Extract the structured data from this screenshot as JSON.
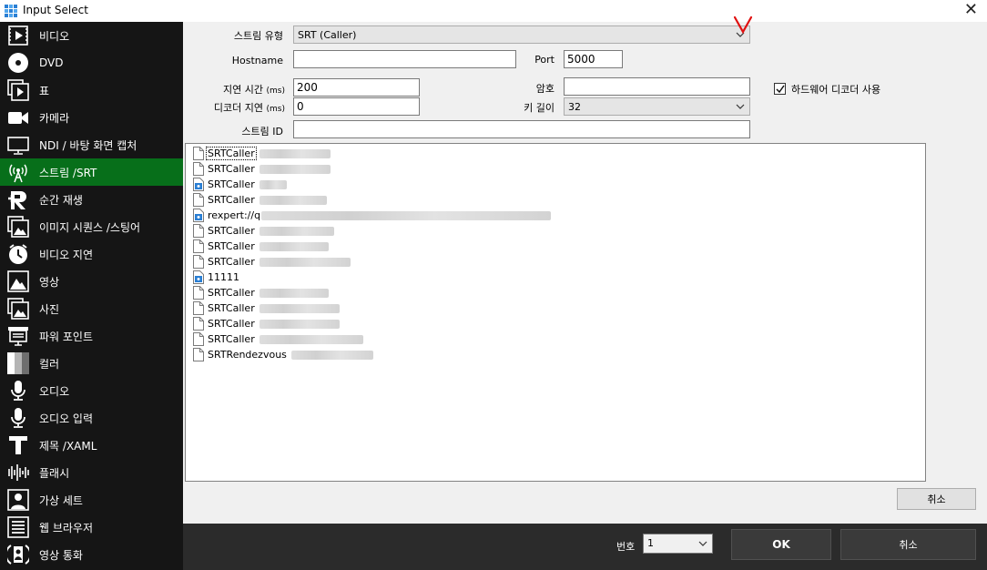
{
  "window": {
    "title": "Input Select",
    "close_glyph": "✕"
  },
  "sidebar": {
    "items": [
      {
        "label": "비디오",
        "icon": "video-icon"
      },
      {
        "label": "DVD",
        "icon": "dvd-icon"
      },
      {
        "label": "표",
        "icon": "list-icon"
      },
      {
        "label": "카메라",
        "icon": "camera-icon"
      },
      {
        "label": "NDI / 바탕 화면 캡처",
        "icon": "ndi-desktop-icon"
      },
      {
        "label": "스트림 /SRT",
        "icon": "stream-antenna-icon",
        "active": true
      },
      {
        "label": "순간 재생",
        "icon": "replay-icon"
      },
      {
        "label": "이미지 시퀀스 /스팅어",
        "icon": "image-sequence-icon"
      },
      {
        "label": "비디오 지연",
        "icon": "video-delay-icon"
      },
      {
        "label": "영상",
        "icon": "image-icon"
      },
      {
        "label": "사진",
        "icon": "photos-icon"
      },
      {
        "label": "파워 포인트",
        "icon": "powerpoint-icon"
      },
      {
        "label": "컬러",
        "icon": "color-icon"
      },
      {
        "label": "오디오",
        "icon": "microphone-icon"
      },
      {
        "label": "오디오 입력",
        "icon": "audio-input-icon"
      },
      {
        "label": "제목 /XAML",
        "icon": "title-icon"
      },
      {
        "label": "플래시",
        "icon": "flash-icon"
      },
      {
        "label": "가상 세트",
        "icon": "virtual-set-icon"
      },
      {
        "label": "웹 브라우저",
        "icon": "web-browser-icon"
      },
      {
        "label": "영상 통화",
        "icon": "video-call-icon"
      }
    ]
  },
  "form": {
    "stream_type": {
      "label": "스트림 유형",
      "value": "SRT (Caller)"
    },
    "hostname": {
      "label": "Hostname",
      "value": ""
    },
    "port": {
      "label": "Port",
      "value": "5000"
    },
    "latency": {
      "label": "지연 시간",
      "unit": "(ms)",
      "value": "200"
    },
    "password": {
      "label": "암호",
      "value": ""
    },
    "hardware_decoder": {
      "label": "하드웨어 디코더 사용",
      "checked": true
    },
    "decoder_delay": {
      "label": "디코더 지연",
      "unit": "(ms)",
      "value": "0"
    },
    "key_length": {
      "label": "키 길이",
      "value": "32"
    },
    "stream_id": {
      "label": "스트림 ID",
      "value": ""
    }
  },
  "annotation": {
    "mark": "V",
    "color": "#e01010"
  },
  "presets": [
    {
      "name": "SRTCaller",
      "icon": "blank-file-icon",
      "focused": true
    },
    {
      "name": "SRTCaller",
      "icon": "blank-file-icon"
    },
    {
      "name": "SRTCaller",
      "icon": "stream-file-icon"
    },
    {
      "name": "SRTCaller",
      "icon": "blank-file-icon"
    },
    {
      "name": "rexpert://q",
      "icon": "stream-file-icon"
    },
    {
      "name": "SRTCaller",
      "icon": "blank-file-icon"
    },
    {
      "name": "SRTCaller",
      "icon": "blank-file-icon"
    },
    {
      "name": "SRTCaller",
      "icon": "blank-file-icon"
    },
    {
      "name": "11111",
      "icon": "stream-file-icon"
    },
    {
      "name": "SRTCaller",
      "icon": "blank-file-icon"
    },
    {
      "name": "SRTCaller",
      "icon": "blank-file-icon"
    },
    {
      "name": "SRTCaller",
      "icon": "blank-file-icon"
    },
    {
      "name": "SRTCaller",
      "icon": "blank-file-icon"
    },
    {
      "name": "SRTRendezvous",
      "icon": "blank-file-icon"
    }
  ],
  "buttons": {
    "cancel_top": "취소",
    "ok": "OK",
    "cancel_bottom": "취소"
  },
  "footer": {
    "number_label": "번호",
    "number_value": "1"
  },
  "colors": {
    "sidebar_bg": "#151515",
    "active_green": "#076f1a",
    "bottom_bar": "#2b2b2b"
  }
}
